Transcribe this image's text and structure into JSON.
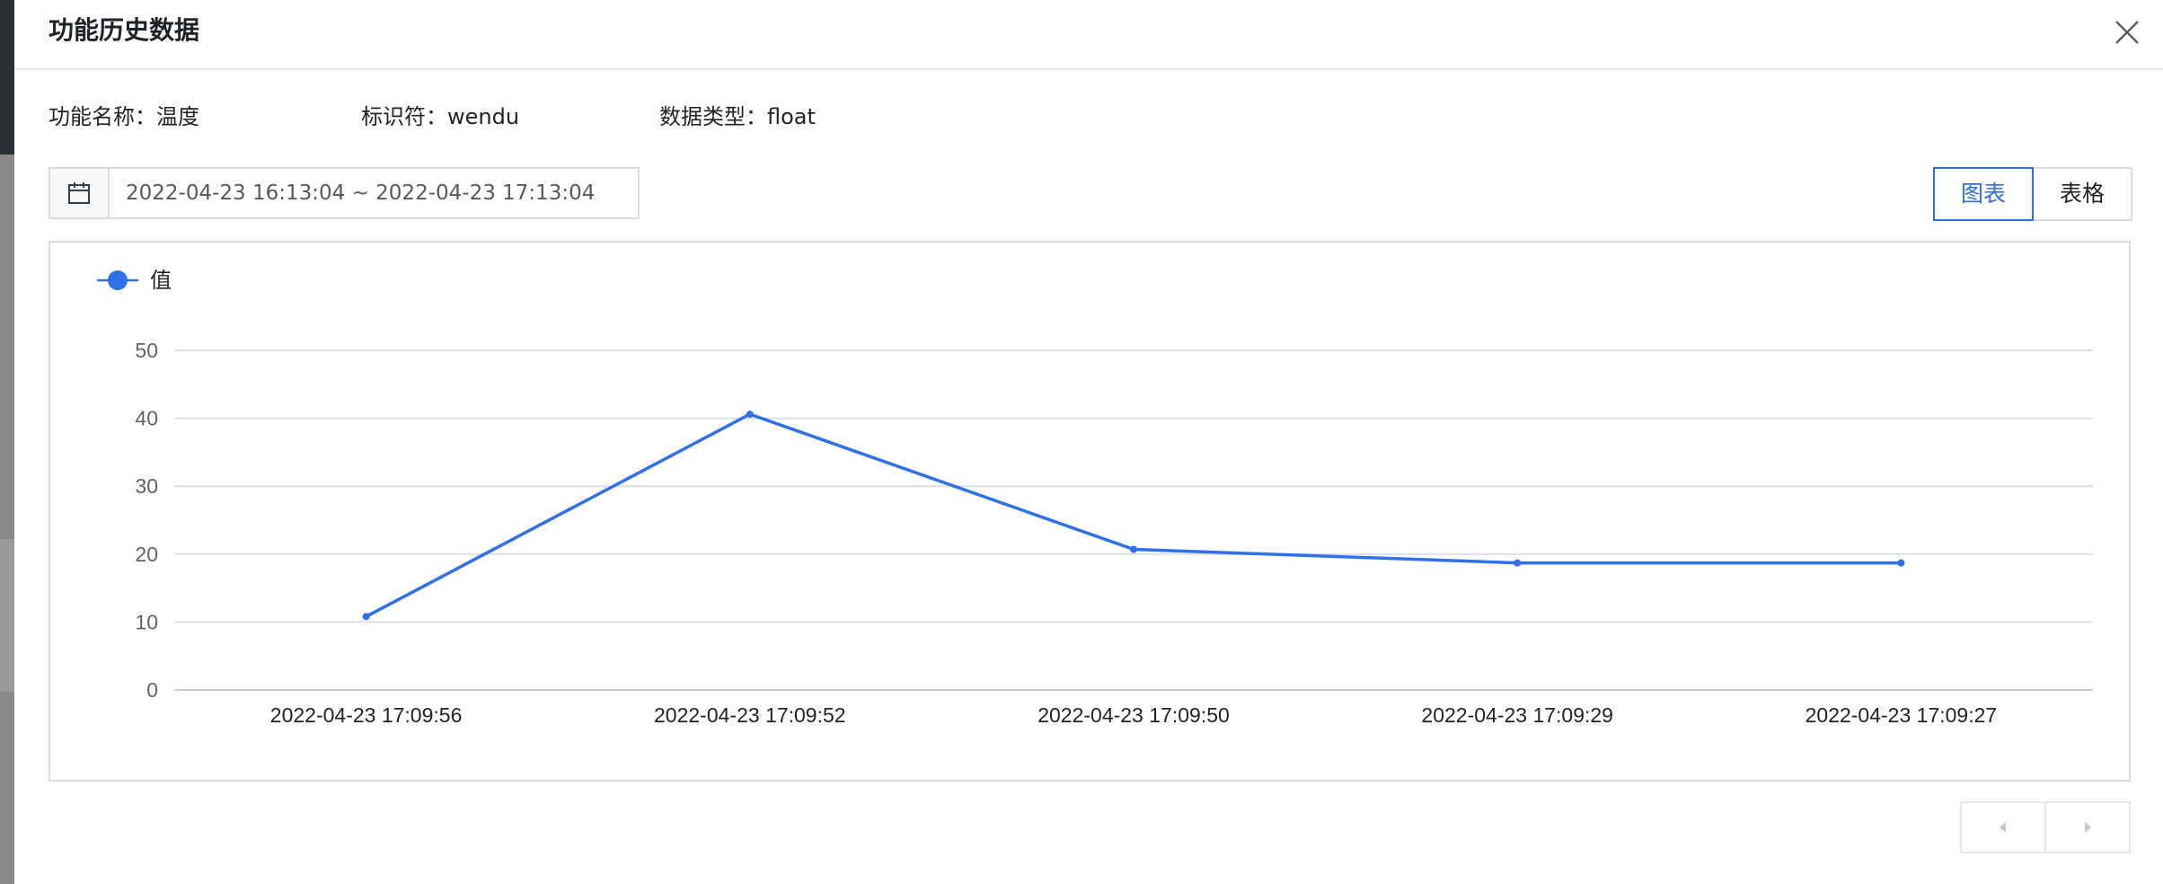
{
  "modal": {
    "title": "功能历史数据",
    "info": {
      "function_name": "功能名称：温度",
      "identifier": "标识符：wendu",
      "data_type": "数据类型：float"
    },
    "date_range": "2022-04-23 16:13:04 ~ 2022-04-23 17:13:04",
    "view_toggle": {
      "chart_label": "图表",
      "table_label": "表格",
      "active": "chart"
    }
  },
  "chart_data": {
    "type": "line",
    "legend": "值",
    "x": [
      "2022-04-23 17:09:56",
      "2022-04-23 17:09:52",
      "2022-04-23 17:09:50",
      "2022-04-23 17:09:29",
      "2022-04-23 17:09:27"
    ],
    "series": [
      {
        "name": "值",
        "values": [
          10.8,
          40.6,
          20.7,
          18.7,
          18.7
        ],
        "color": "#3070e8"
      }
    ],
    "ylim": [
      0,
      50
    ],
    "yticks": [
      0,
      10,
      20,
      30,
      40,
      50
    ],
    "grid": true,
    "legend_position": "top-left"
  },
  "colors": {
    "accent": "#2e6ed8",
    "line": "#3070e8",
    "grid": "#dcdfe3"
  },
  "icons": {
    "close": "close-icon",
    "calendar": "calendar-icon",
    "prev": "chevron-left-icon",
    "next": "chevron-right-icon"
  }
}
